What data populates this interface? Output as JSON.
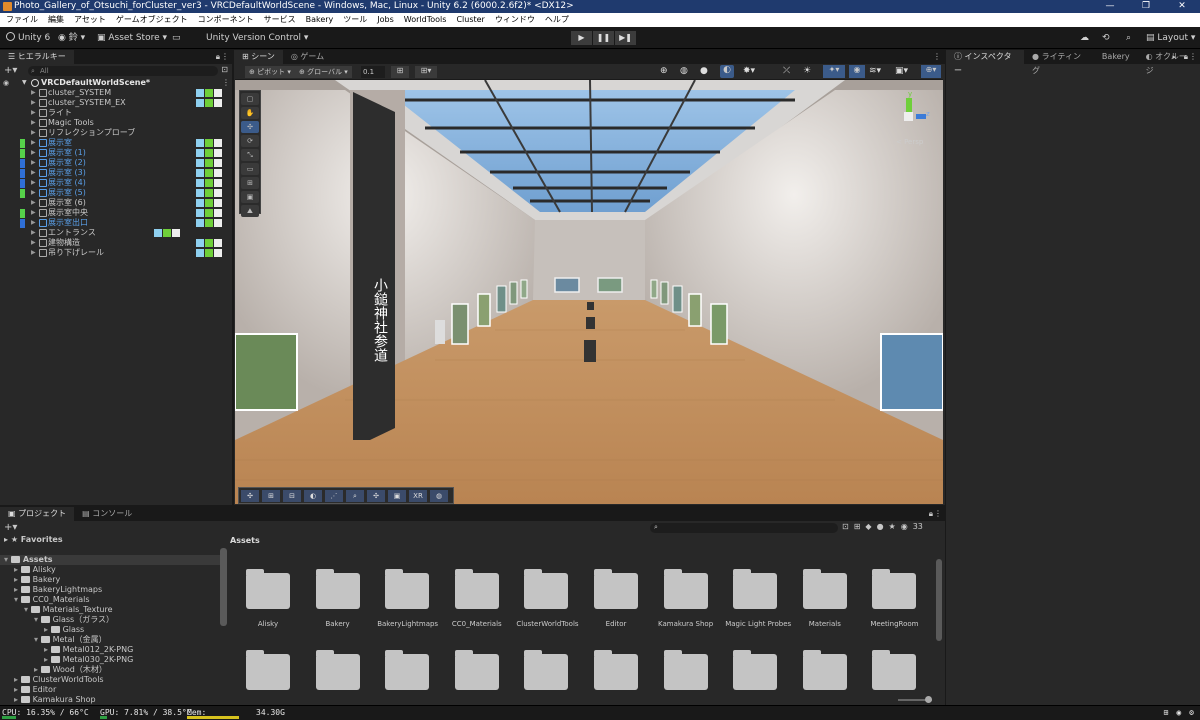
{
  "window": {
    "title": "Photo_Gallery_of_Otsuchi_forCluster_ver3 - VRCDefaultWorldScene - Windows, Mac, Linux - Unity 6.2 (6000.2.6f2)* <DX12>",
    "controls": [
      "—",
      "❐",
      "✕"
    ]
  },
  "menu": [
    "ファイル",
    "編集",
    "アセット",
    "ゲームオブジェクト",
    "コンポーネント",
    "サービス",
    "Bakery",
    "ツール",
    "Jobs",
    "WorldTools",
    "Cluster",
    "ウィンドウ",
    "ヘルプ"
  ],
  "toolbar": {
    "unity_label": "Unity 6",
    "account_label": "鈴",
    "asset_store": "Asset Store",
    "version_control": "Unity Version Control",
    "play": "▶",
    "pause": "❚❚",
    "step": "▶❚",
    "layout": "Layout"
  },
  "hierarchy": {
    "tab": "ヒエラルキー",
    "search_placeholder": "All",
    "scene_name": "VRCDefaultWorldScene*",
    "items": [
      {
        "name": "cluster_SYSTEM",
        "blue": false
      },
      {
        "name": "cluster_SYSTEM_EX",
        "blue": false
      },
      {
        "name": "ライト",
        "blue": false
      },
      {
        "name": "Magic Tools",
        "blue": false
      },
      {
        "name": "リフレクションプローブ",
        "blue": false
      },
      {
        "name": "展示室",
        "blue": true
      },
      {
        "name": "展示室 (1)",
        "blue": true
      },
      {
        "name": "展示室 (2)",
        "blue": true
      },
      {
        "name": "展示室 (3)",
        "blue": true
      },
      {
        "name": "展示室 (4)",
        "blue": true
      },
      {
        "name": "展示室 (5)",
        "blue": true
      },
      {
        "name": "展示室 (6)",
        "blue": false
      },
      {
        "name": "展示室中央",
        "blue": false
      },
      {
        "name": "展示室出口",
        "blue": true
      },
      {
        "name": "エントランス",
        "blue": false
      },
      {
        "name": "建物構造",
        "blue": false
      },
      {
        "name": "吊り下げレール",
        "blue": false
      }
    ]
  },
  "scene": {
    "tabs": [
      "シーン",
      "ゲーム"
    ],
    "pivot": "ピボット",
    "global": "グローバル",
    "snap_value": "0.1",
    "persp_label": "< Persp",
    "axis_y": "y",
    "axis_z": "z",
    "banner_text": "小鎚神社参道",
    "overlay_xr": "XR"
  },
  "inspector": {
    "tabs": [
      "インスペクター",
      "ライティング",
      "Bakery",
      "オクルージ"
    ]
  },
  "project": {
    "tabs": [
      "プロジェクト",
      "コンソール"
    ],
    "favorites": "Favorites",
    "assets_header": "Assets",
    "count": "33",
    "tree": [
      {
        "name": "Assets",
        "indent": 0,
        "open": true
      },
      {
        "name": "Alisky",
        "indent": 1,
        "open": false
      },
      {
        "name": "Bakery",
        "indent": 1,
        "open": false
      },
      {
        "name": "BakeryLightmaps",
        "indent": 1,
        "open": false
      },
      {
        "name": "CC0_Materials",
        "indent": 1,
        "open": true
      },
      {
        "name": "Materials_Texture",
        "indent": 2,
        "open": true
      },
      {
        "name": "Glass（ガラス）",
        "indent": 3,
        "open": true
      },
      {
        "name": "Glass",
        "indent": 4,
        "open": false
      },
      {
        "name": "Metal（金属）",
        "indent": 3,
        "open": true
      },
      {
        "name": "Metal012_2K-PNG",
        "indent": 4,
        "open": false
      },
      {
        "name": "Metal030_2K-PNG",
        "indent": 4,
        "open": false
      },
      {
        "name": "Wood（木材）",
        "indent": 3,
        "open": false
      },
      {
        "name": "ClusterWorldTools",
        "indent": 1,
        "open": false
      },
      {
        "name": "Editor",
        "indent": 1,
        "open": false
      },
      {
        "name": "Kamakura Shop",
        "indent": 1,
        "open": false
      }
    ],
    "assets": [
      "Alisky",
      "Bakery",
      "BakeryLightmaps",
      "CC0_Materials",
      "ClusterWorldTools",
      "Editor",
      "Kamakura Shop",
      "Magic Light Probes",
      "Materials",
      "MeetingRoom",
      "",
      "",
      "",
      "",
      "",
      "",
      "",
      "",
      "",
      ""
    ]
  },
  "status": {
    "cpu": "CPU: 16.35% / 66°C",
    "gpu": "GPU: 7.81% / 38.5°C",
    "mem_label": "Mem:",
    "mem_value": "34.30G",
    "cpu_level": 0.16,
    "gpu_level": 0.08,
    "mem_level": 0.52
  }
}
